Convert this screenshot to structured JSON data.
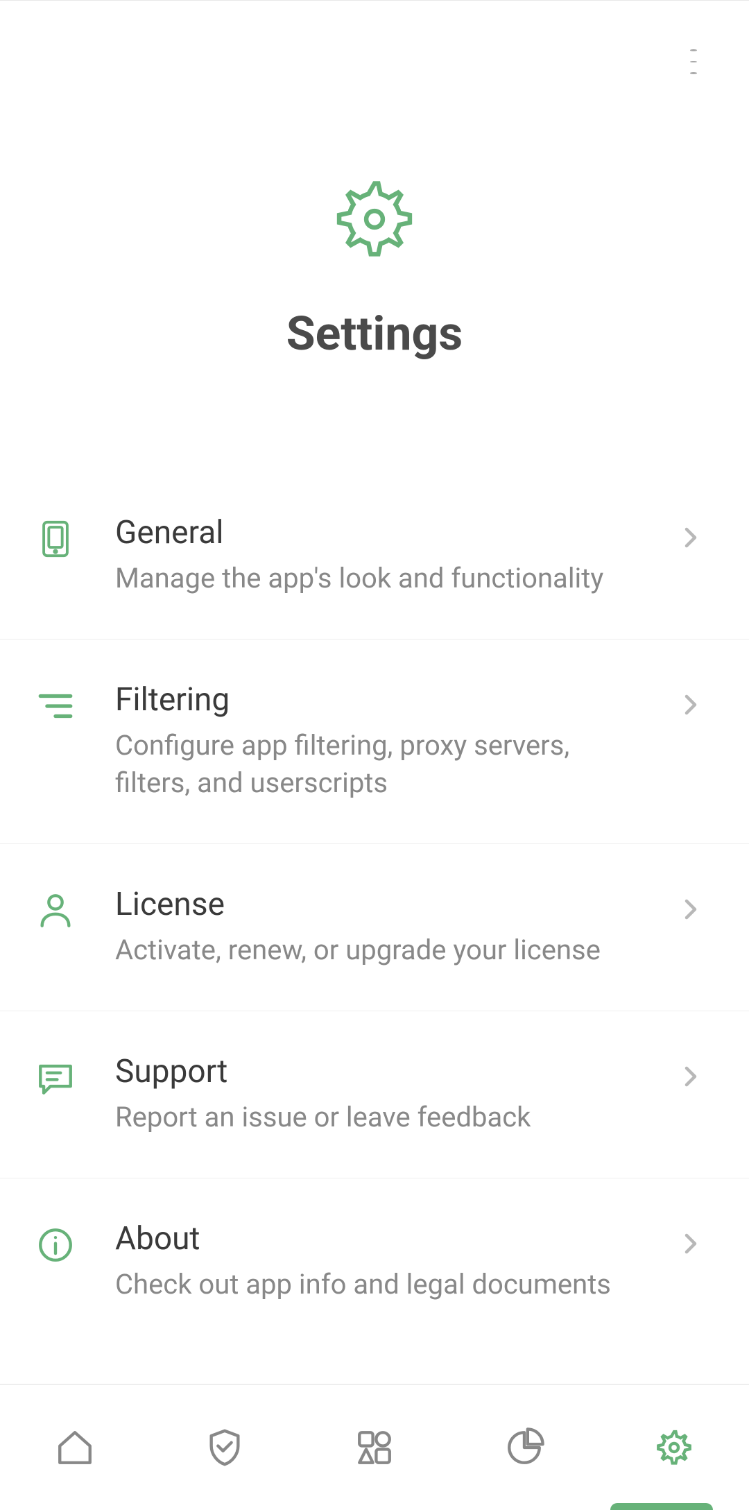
{
  "colors": {
    "accent": "#67b279",
    "text_primary": "#4a4a4a",
    "text_title": "#3a3a3a",
    "text_secondary": "#888888",
    "icon_inactive": "#888888",
    "divider": "#eeeeee"
  },
  "header": {
    "title": "Settings",
    "icon": "gear-icon"
  },
  "settings": [
    {
      "icon": "device-icon",
      "title": "General",
      "subtitle": "Manage the app's look and functionality"
    },
    {
      "icon": "filter-icon",
      "title": "Filtering",
      "subtitle": "Configure app filtering, proxy servers, filters, and userscripts"
    },
    {
      "icon": "user-icon",
      "title": "License",
      "subtitle": "Activate, renew, or upgrade your license"
    },
    {
      "icon": "message-icon",
      "title": "Support",
      "subtitle": "Report an issue or leave feedback"
    },
    {
      "icon": "info-icon",
      "title": "About",
      "subtitle": "Check out app info and legal documents"
    }
  ],
  "bottom_nav": {
    "items": [
      {
        "icon": "home-icon",
        "active": false
      },
      {
        "icon": "shield-check-icon",
        "active": false
      },
      {
        "icon": "apps-icon",
        "active": false
      },
      {
        "icon": "chart-icon",
        "active": false
      },
      {
        "icon": "gear-small-icon",
        "active": true
      }
    ]
  }
}
